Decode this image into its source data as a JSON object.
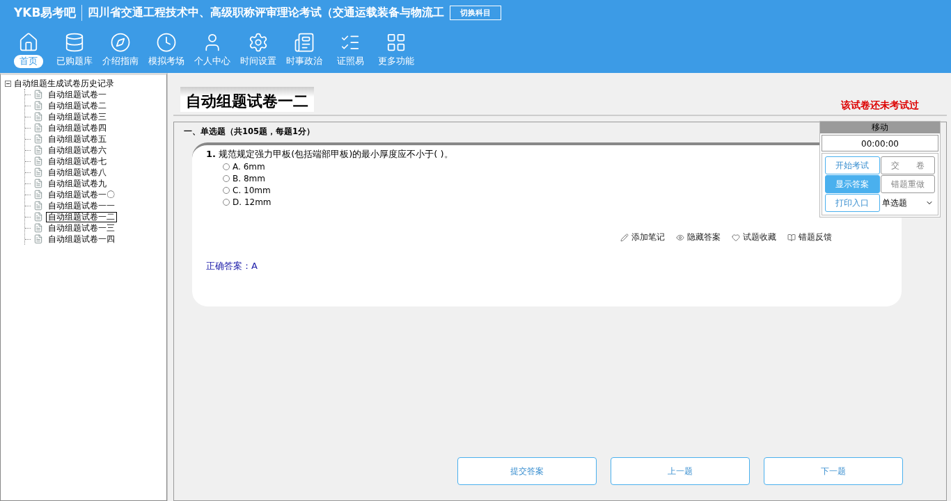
{
  "header": {
    "brand": "YKB易考吧",
    "title": "四川省交通工程技术中、高级职称评审理论考试（交通运载装备与物流工",
    "switch_button": "切换科目"
  },
  "nav": [
    {
      "label": "首页",
      "selected": true
    },
    {
      "label": "已购题库",
      "selected": false
    },
    {
      "label": "介绍指南",
      "selected": false
    },
    {
      "label": "模拟考场",
      "selected": false
    },
    {
      "label": "个人中心",
      "selected": false
    },
    {
      "label": "时间设置",
      "selected": false
    },
    {
      "label": "时事政治",
      "selected": false
    },
    {
      "label": "证照易",
      "selected": false
    },
    {
      "label": "更多功能",
      "selected": false
    }
  ],
  "tree": {
    "label": "自动组题生成试卷历史记录",
    "expanded": true,
    "children": [
      {
        "label": "自动组题试卷一",
        "selected": false
      },
      {
        "label": "自动组题试卷二",
        "selected": false
      },
      {
        "label": "自动组题试卷三",
        "selected": false
      },
      {
        "label": "自动组题试卷四",
        "selected": false
      },
      {
        "label": "自动组题试卷五",
        "selected": false
      },
      {
        "label": "自动组题试卷六",
        "selected": false
      },
      {
        "label": "自动组题试卷七",
        "selected": false
      },
      {
        "label": "自动组题试卷八",
        "selected": false
      },
      {
        "label": "自动组题试卷九",
        "selected": false
      },
      {
        "label": "自动组题试卷一〇",
        "selected": false
      },
      {
        "label": "自动组题试卷一一",
        "selected": false
      },
      {
        "label": "自动组题试卷一二",
        "selected": true
      },
      {
        "label": "自动组题试卷一三",
        "selected": false
      },
      {
        "label": "自动组题试卷一四",
        "selected": false
      }
    ]
  },
  "paper": {
    "title": "自动组题试卷一二",
    "status": "该试卷还未考试过"
  },
  "section": "一、单选题（共105题，每题1分）",
  "question": {
    "number": "1.",
    "text": "规范规定强力甲板(包括端部甲板)的最小厚度应不小于( )。",
    "options": [
      {
        "letter": "A.",
        "text": "6mm",
        "checked": false
      },
      {
        "letter": "B.",
        "text": "8mm",
        "checked": false
      },
      {
        "letter": "C.",
        "text": "10mm",
        "checked": false
      },
      {
        "letter": "D.",
        "text": "12mm",
        "checked": false
      }
    ],
    "actions": [
      "添加笔记",
      "隐藏答案",
      "试题收藏",
      "错题反馈"
    ],
    "answer_label": "正确答案：",
    "answer": "A"
  },
  "panel": {
    "title": "移动",
    "timer": "00:00:00",
    "buttons": [
      {
        "label": "开始考试",
        "kind": "outline",
        "active": false
      },
      {
        "label": "交　　卷",
        "kind": "plain",
        "active": false
      },
      {
        "label": "显示答案",
        "kind": "outline",
        "active": true
      },
      {
        "label": "错题重做",
        "kind": "plain",
        "active": false
      },
      {
        "label": "打印入口",
        "kind": "outline",
        "active": false
      }
    ],
    "select": "单选题"
  },
  "footer_buttons": [
    "提交答案",
    "上一题",
    "下一题"
  ]
}
